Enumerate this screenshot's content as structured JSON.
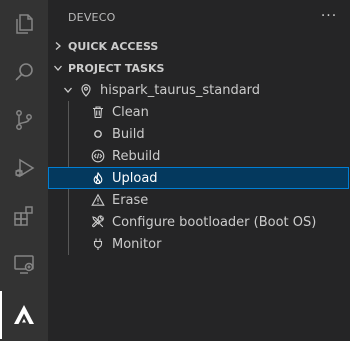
{
  "activity_bar": {
    "icons": [
      "explorer-icon",
      "search-icon",
      "source-control-icon",
      "run-debug-icon",
      "extensions-icon",
      "remote-explorer-icon",
      "deveco-icon"
    ]
  },
  "sidebar": {
    "title": "DEVECO",
    "more_label": "···",
    "sections": [
      {
        "label": "QUICK ACCESS",
        "expanded": false
      },
      {
        "label": "PROJECT TASKS",
        "expanded": true
      }
    ],
    "project": {
      "name": "hispark_taurus_standard"
    },
    "tasks": [
      {
        "label": "Clean",
        "icon": "trash-icon"
      },
      {
        "label": "Build",
        "icon": "circle-icon"
      },
      {
        "label": "Rebuild",
        "icon": "code-icon"
      },
      {
        "label": "Upload",
        "icon": "flame-icon",
        "selected": true
      },
      {
        "label": "Erase",
        "icon": "warning-icon"
      },
      {
        "label": "Configure bootloader (Boot OS)",
        "icon": "tools-icon"
      },
      {
        "label": "Monitor",
        "icon": "plug-icon"
      }
    ]
  },
  "colors": {
    "activity_bar_bg": "#333333",
    "sidebar_bg": "#252526",
    "selection_bg": "#04395e",
    "selection_border": "#007fd4"
  }
}
